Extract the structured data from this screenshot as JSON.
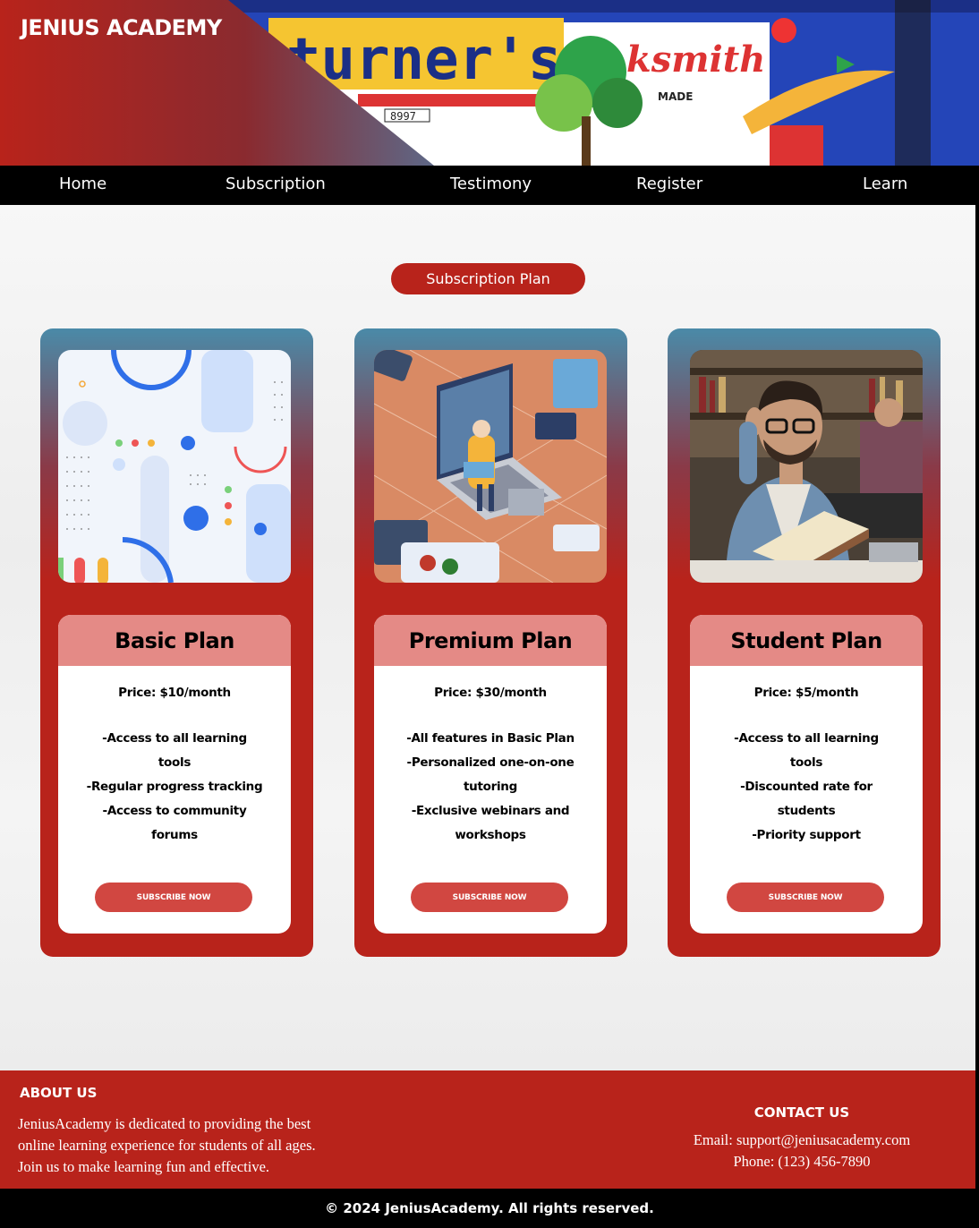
{
  "header": {
    "brand": "JENIUS ACADEMY"
  },
  "nav": {
    "items": [
      "Home",
      "Subscription",
      "Testimony",
      "Register",
      "Learn"
    ]
  },
  "section": {
    "title": "Subscription Plan"
  },
  "plans": [
    {
      "name": "Basic Plan",
      "price": "Price: $10/month",
      "features": [
        "-Access to all learning tools",
        "-Regular progress tracking",
        "-Access to community forums"
      ],
      "button": "SUBSCRIBE NOW"
    },
    {
      "name": "Premium Plan",
      "price": "Price: $30/month",
      "features": [
        "-All features in Basic Plan",
        "-Personalized one-on-one tutoring",
        "-Exclusive webinars and workshops"
      ],
      "button": "SUBSCRIBE NOW"
    },
    {
      "name": "Student Plan",
      "price": "Price: $5/month",
      "features": [
        "-Access to all learning tools",
        "-Discounted rate for students",
        "-Priority support"
      ],
      "button": "SUBSCRIBE NOW"
    }
  ],
  "footer": {
    "about_title": "ABOUT US",
    "about_text": "JeniusAcademy is dedicated to providing the best online learning experience for students of all ages. Join us to make learning fun and effective.",
    "contact_title": "CONTACT US",
    "email": "Email: support@jeniusacademy.com",
    "phone": "Phone: (123) 456-7890",
    "copyright": "© 2024 JeniusAcademy. All rights reserved."
  },
  "colors": {
    "primary_red": "#b8231b",
    "header_pink": "#e48a86",
    "teal": "#4a8aa8",
    "button_red": "#d14741"
  },
  "icons": [
    "basic-plan-illustration",
    "premium-plan-illustration",
    "student-plan-photo"
  ]
}
